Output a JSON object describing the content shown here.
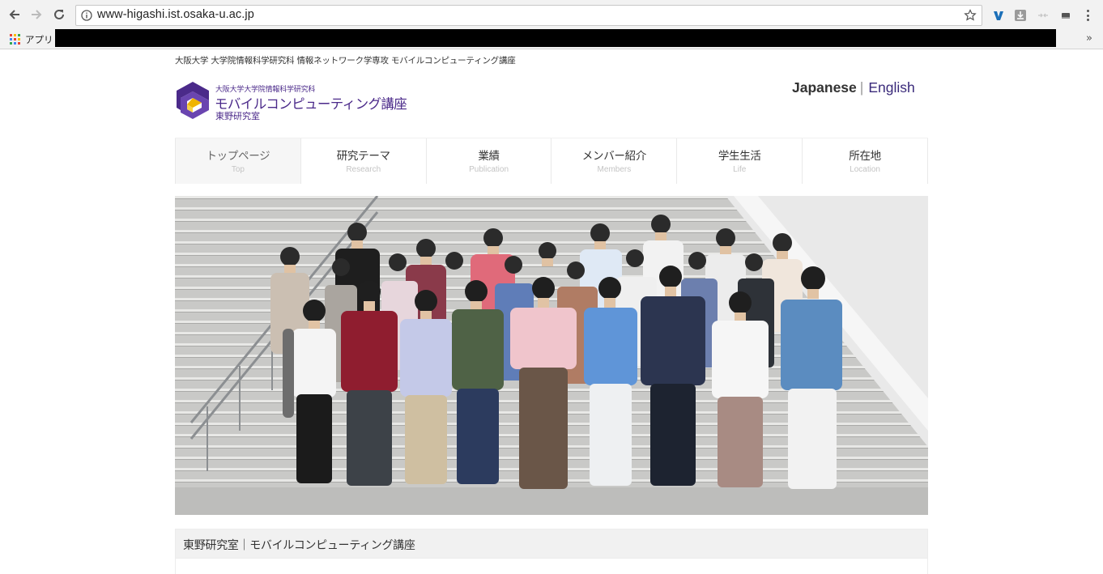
{
  "browser": {
    "url": "www-higashi.ist.osaka-u.ac.jp",
    "bookmarks_apps_label": "アプリ",
    "bookmarks_more": "»"
  },
  "site": {
    "breadcrumb": "大阪大学 大学院情報科学研究科 情報ネットワーク学専攻 モバイルコンピューティング講座",
    "logo": {
      "subtitle": "大阪大学大学院情報科学研究科",
      "title": "モバイルコンピューティング講座",
      "lab": "東野研究室",
      "brand_color": "#4b2a8a"
    },
    "language": {
      "japanese": "Japanese",
      "separator": "|",
      "english": "English"
    },
    "nav": [
      {
        "jp": "トップページ",
        "en": "Top",
        "active": true
      },
      {
        "jp": "研究テーマ",
        "en": "Research",
        "active": false
      },
      {
        "jp": "業績",
        "en": "Publication",
        "active": false
      },
      {
        "jp": "メンバー紹介",
        "en": "Members",
        "active": false
      },
      {
        "jp": "学生生活",
        "en": "Life",
        "active": false
      },
      {
        "jp": "所在地",
        "en": "Location",
        "active": false
      }
    ],
    "hero_image": "group-photo-on-stairs",
    "section_title": "東野研究室｜モバイルコンピューティング講座"
  }
}
